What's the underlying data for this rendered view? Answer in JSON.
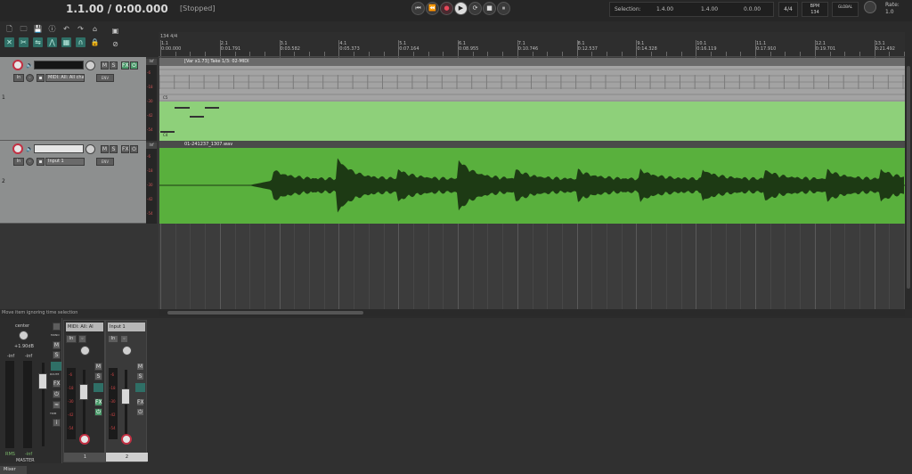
{
  "transport": {
    "position": "1.1.00 / 0:00.000",
    "status": "[Stopped]",
    "buttons": [
      "⏮",
      "⏪",
      "●",
      "▶",
      "⟳",
      "■",
      "⏸"
    ]
  },
  "selection": {
    "label": "Selection:",
    "start": "1.4.00",
    "end": "1.4.00",
    "length": "0.0.00"
  },
  "time_signature": "4/4",
  "bpm": {
    "label": "BPM",
    "value": "134"
  },
  "global": "GLOBAL",
  "rate": {
    "label": "Rate:",
    "value": "1.0"
  },
  "toolbar": {
    "row1": [
      "🗋",
      "🗀",
      "💾",
      "ⓘ",
      "↶",
      "↷",
      "⌂",
      "▣"
    ],
    "row2": [
      "✕",
      "✂",
      "⇋",
      "⋀",
      "▦",
      "∩",
      "🔒",
      "⊘"
    ]
  },
  "tracks": [
    {
      "number": "1",
      "name": "",
      "input": "In",
      "input_source": "MIDI: All: All chan",
      "env": "ENV",
      "fx": "FX"
    },
    {
      "number": "2",
      "name": "",
      "input": "In",
      "input_source": "Input 1",
      "env": "ENV",
      "fx": "FX"
    }
  ],
  "ruler": {
    "tempo_marker": "134 4/4",
    "bars": [
      {
        "bar": "1.1",
        "time": "0:00.000"
      },
      {
        "bar": "2.1",
        "time": "0:01.791"
      },
      {
        "bar": "3.1",
        "time": "0:03.582"
      },
      {
        "bar": "4.1",
        "time": "0:05.373"
      },
      {
        "bar": "5.1",
        "time": "0:07.164"
      },
      {
        "bar": "6.1",
        "time": "0:08.955"
      },
      {
        "bar": "7.1",
        "time": "0:10.746"
      },
      {
        "bar": "8.1",
        "time": "0:12.537"
      },
      {
        "bar": "9.1",
        "time": "0:14.328"
      },
      {
        "bar": "10.1",
        "time": "0:16.119"
      },
      {
        "bar": "11.1",
        "time": "0:17.910"
      },
      {
        "bar": "12.1",
        "time": "0:19.701"
      },
      {
        "bar": "13.1",
        "time": "0:21.492"
      }
    ]
  },
  "items": {
    "midi": {
      "label": "[Var x1.73] Take 1/3: 02-MIDI",
      "note_label": "C5",
      "note_label2": "C4"
    },
    "audio": {
      "label": "01-241237_1307.wav"
    }
  },
  "status_line": "Move item ignoring time selection",
  "mixer": {
    "master": {
      "pan_label": "center",
      "gain": "+1.90dB",
      "left": "-inf",
      "right": "-inf",
      "rms": "RMS",
      "db": "-inf",
      "name": "MASTER",
      "buttons": [
        "M",
        "S",
        "ROUTE",
        "FX",
        "TRIM"
      ],
      "mono": "MONO"
    },
    "channels": [
      {
        "name": "MIDI: All: Al",
        "number": "1",
        "input": "In",
        "mute": "M",
        "solo": "S",
        "fx": "FX"
      },
      {
        "name": "Input 1",
        "number": "2",
        "input": "In",
        "mute": "M",
        "solo": "S",
        "fx": "FX"
      }
    ],
    "scale": [
      "-6",
      "-18",
      "-30",
      "-42",
      "-54"
    ],
    "tab": "Mixer"
  },
  "colors": {
    "midi_item": "#8ed07a",
    "audio_item": "#59b03d",
    "waveform": "#1d3a14",
    "record_arm": "#c23043",
    "accent_teal": "#2f6f66"
  }
}
